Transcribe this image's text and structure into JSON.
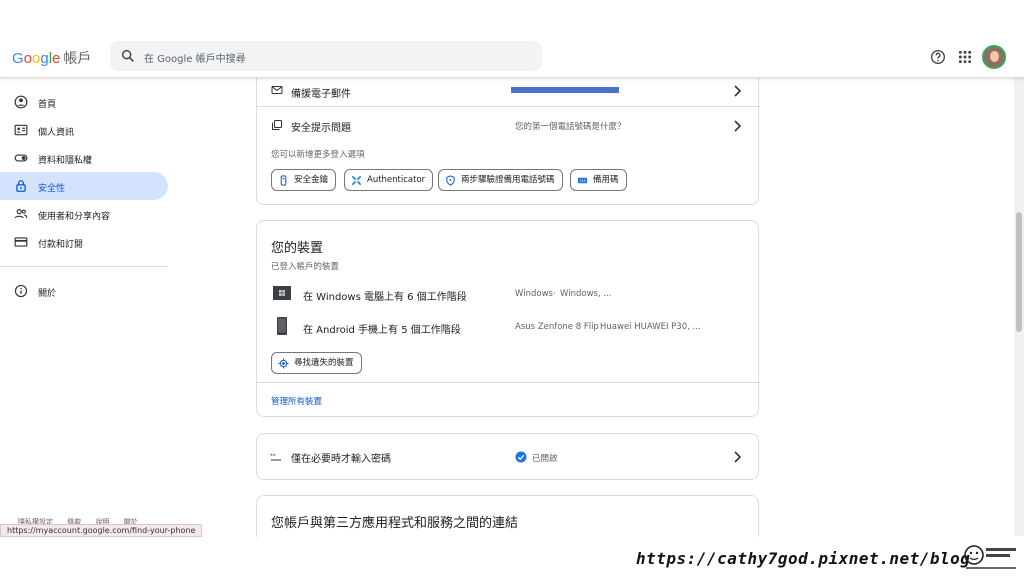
{
  "header": {
    "logo_google": "Google",
    "logo_suffix": "帳戶",
    "search_placeholder": "在 Google 帳戶中搜尋",
    "help_icon": "help-icon",
    "apps_icon": "apps-grid-icon",
    "avatar_icon": "avatar"
  },
  "sidebar": {
    "items": [
      {
        "label": "首頁",
        "icon": "home-icon"
      },
      {
        "label": "個人資訊",
        "icon": "id-card-icon"
      },
      {
        "label": "資料和隱私權",
        "icon": "toggle-icon"
      },
      {
        "label": "安全性",
        "icon": "lock-icon",
        "active": true
      },
      {
        "label": "使用者和分享內容",
        "icon": "people-icon"
      },
      {
        "label": "付款和訂閱",
        "icon": "credit-card-icon"
      }
    ],
    "about": {
      "label": "關於",
      "icon": "info-icon"
    },
    "footer_links": [
      "隱私權設定",
      "條款",
      "說明",
      "關於"
    ]
  },
  "status_url": "https://myaccount.google.com/find-your-phone",
  "signin_card": {
    "backup_email_label": "備援電子郵件",
    "security_question_label": "安全提示問題",
    "security_question_value": "您的第一個電話號碼是什麼？",
    "more_options_text": "您可以新增更多登入選項",
    "chips": [
      "安全金鑰",
      "Authenticator",
      "兩步驟驗證備用電話號碼",
      "備用碼"
    ]
  },
  "devices_card": {
    "title": "您的裝置",
    "subtitle": "已登入帳戶的裝置",
    "devices": [
      {
        "label": "在 Windows 電腦上有 6 個工作階段",
        "detail1": "Windows",
        "detail2": "Windows, ..."
      },
      {
        "label": "在 Android 手機上有 5 個工作階段",
        "detail1": "Asus Zenfone 8 Flip",
        "detail2": "Huawei HUAWEI P30, ..."
      }
    ],
    "find_device_button": "尋找遺失的裝置",
    "manage_link": "管理所有裝置"
  },
  "password_card": {
    "label": "僅在必要時才輸入密碼",
    "status": "已開啟"
  },
  "third_party_card": {
    "title": "您帳戶與第三方應用程式和服務之間的連結"
  },
  "watermark": "https://cathy7god.pixnet.net/blog",
  "colors": {
    "active_nav": "#d3e3fd",
    "link_blue": "#0b57d0",
    "check_blue": "#1a73e8",
    "redaction_blue": "#4a72c4"
  }
}
